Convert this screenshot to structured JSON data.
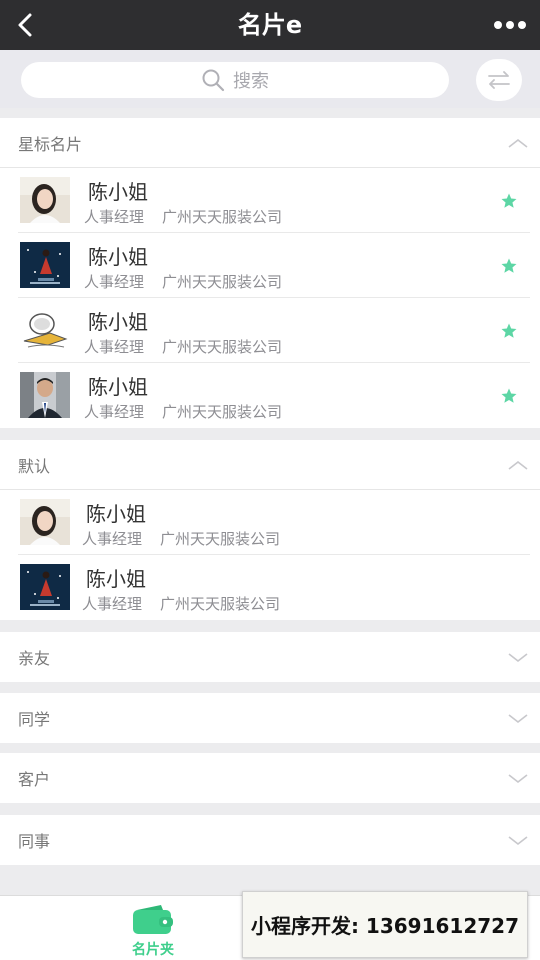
{
  "navbar": {
    "title": "名片e",
    "back_icon": "chevron-left-icon",
    "more_icon": "more-dots-icon"
  },
  "search": {
    "placeholder": "搜索",
    "icon": "search-icon",
    "switch_icon": "swap-arrows-icon"
  },
  "sections": {
    "starred": {
      "title": "星标名片",
      "expanded": true,
      "cards": [
        {
          "name": "陈小姐",
          "title": "人事经理",
          "company": "广州天天服装公司",
          "avatar": "photo-woman",
          "starred": true
        },
        {
          "name": "陈小姐",
          "title": "人事经理",
          "company": "广州天天服装公司",
          "avatar": "goodnight-art",
          "starred": true
        },
        {
          "name": "陈小姐",
          "title": "人事经理",
          "company": "广州天天服装公司",
          "avatar": "cartoon-sketch",
          "starred": true
        },
        {
          "name": "陈小姐",
          "title": "人事经理",
          "company": "广州天天服装公司",
          "avatar": "photo-man",
          "starred": true
        }
      ]
    },
    "default": {
      "title": "默认",
      "expanded": true,
      "cards": [
        {
          "name": "陈小姐",
          "title": "人事经理",
          "company": "广州天天服装公司",
          "avatar": "photo-woman",
          "starred": false
        },
        {
          "name": "陈小姐",
          "title": "人事经理",
          "company": "广州天天服装公司",
          "avatar": "goodnight-art",
          "starred": false
        }
      ]
    },
    "family": {
      "title": "亲友",
      "expanded": false
    },
    "classmates": {
      "title": "同学",
      "expanded": false
    },
    "clients": {
      "title": "客户",
      "expanded": false
    },
    "colleagues": {
      "title": "同事",
      "expanded": false
    }
  },
  "tabbar": {
    "tab_label": "名片夹",
    "tab_icon": "wallet-icon",
    "active_color": "#3fcf8c"
  },
  "overlay": {
    "text": "小程序开发: 13691612727"
  },
  "colors": {
    "navbar_bg": "#2e2e30",
    "accent": "#3fcf8c",
    "star": "#5dd6a5"
  }
}
